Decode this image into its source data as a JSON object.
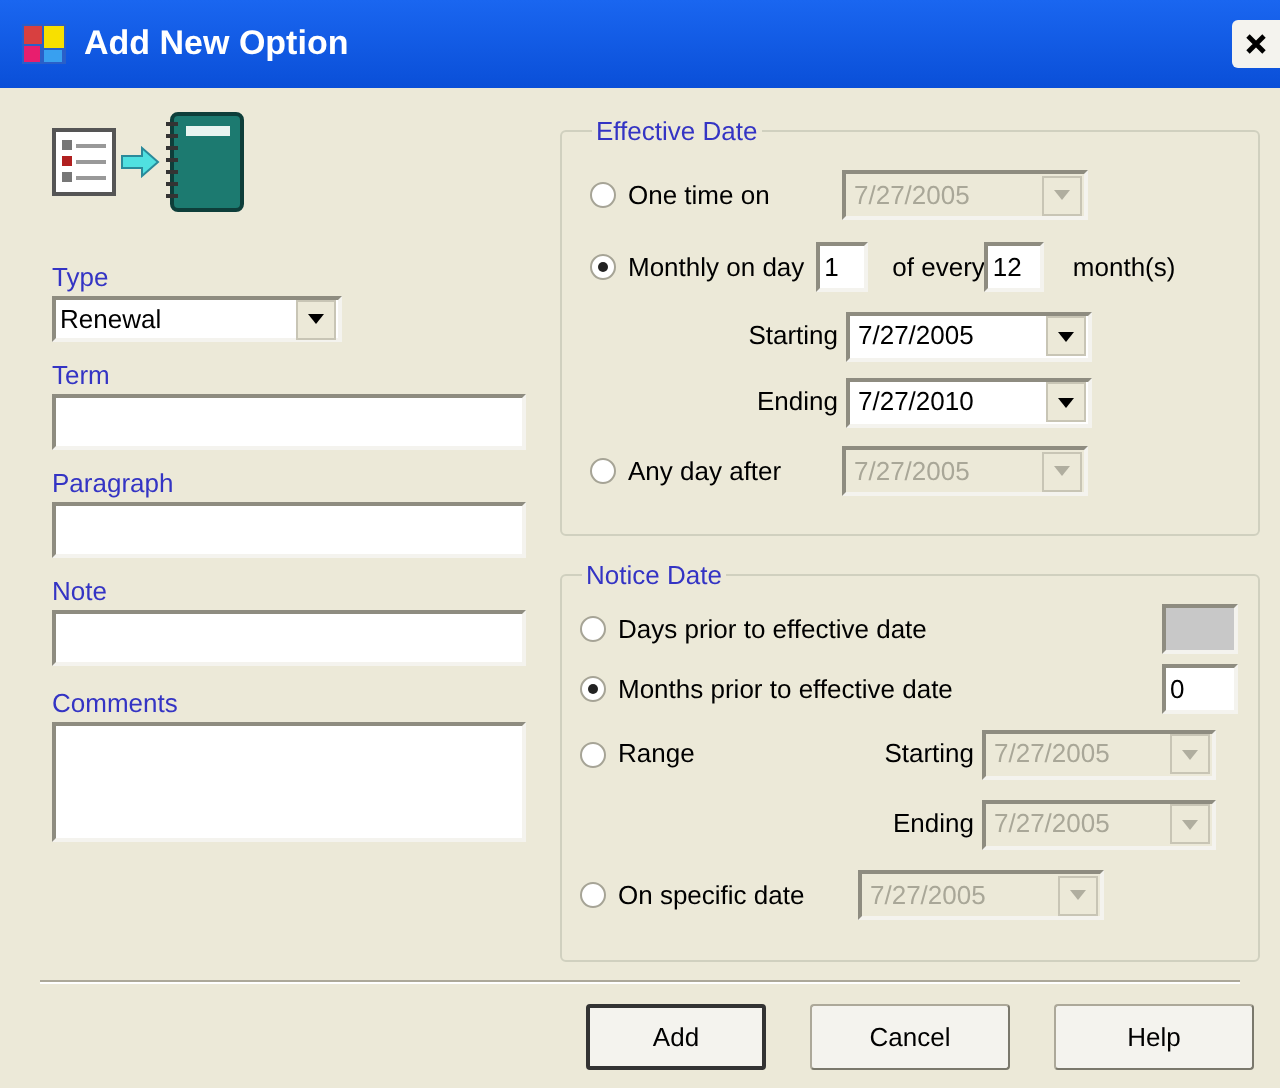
{
  "window": {
    "title": "Add New Option"
  },
  "fields": [
    {
      "label": "Type",
      "kind": "dropdown",
      "value": "Renewal"
    },
    {
      "label": "Term",
      "kind": "text"
    },
    {
      "label": "Paragraph",
      "kind": "text"
    },
    {
      "label": "Note",
      "kind": "text"
    },
    {
      "label": "Comments",
      "kind": "textarea"
    }
  ],
  "effective_date": {
    "title": "Effective Date",
    "options": [
      {
        "label": "One time on",
        "kind": "date",
        "selected": false,
        "date": {
          "value": "7/27/2005",
          "disabled": true
        }
      },
      {
        "label": "Monthly on day",
        "kind": "monthly",
        "selected": true,
        "day": "1",
        "middle": "of every",
        "interval": "12",
        "unit": "month(s)",
        "rows": [
          {
            "label": "Starting",
            "value": "7/27/2005",
            "disabled": false
          },
          {
            "label": "Ending",
            "value": "7/27/2010",
            "disabled": false
          }
        ]
      },
      {
        "label": "Any day after",
        "kind": "date",
        "selected": false,
        "date": {
          "value": "7/27/2005",
          "disabled": true
        }
      }
    ]
  },
  "notice_date": {
    "title": "Notice Date",
    "options": [
      {
        "label": "Days prior to effective date",
        "kind": "number",
        "selected": false,
        "field": {
          "disabled": true
        }
      },
      {
        "label": "Months prior to effective date",
        "kind": "number",
        "selected": true,
        "field": {
          "value": "0",
          "disabled": false
        }
      },
      {
        "label": "Range",
        "kind": "range",
        "selected": false,
        "rows": [
          {
            "label": "Starting",
            "value": "7/27/2005",
            "disabled": true
          },
          {
            "label": "Ending",
            "value": "7/27/2005",
            "disabled": true
          }
        ]
      },
      {
        "label": "On specific date",
        "kind": "date",
        "selected": false,
        "date": {
          "value": "7/27/2005",
          "disabled": true
        }
      }
    ]
  },
  "buttons": [
    {
      "label": "Add",
      "default": true
    },
    {
      "label": "Cancel",
      "default": false
    },
    {
      "label": "Help",
      "default": false
    }
  ]
}
